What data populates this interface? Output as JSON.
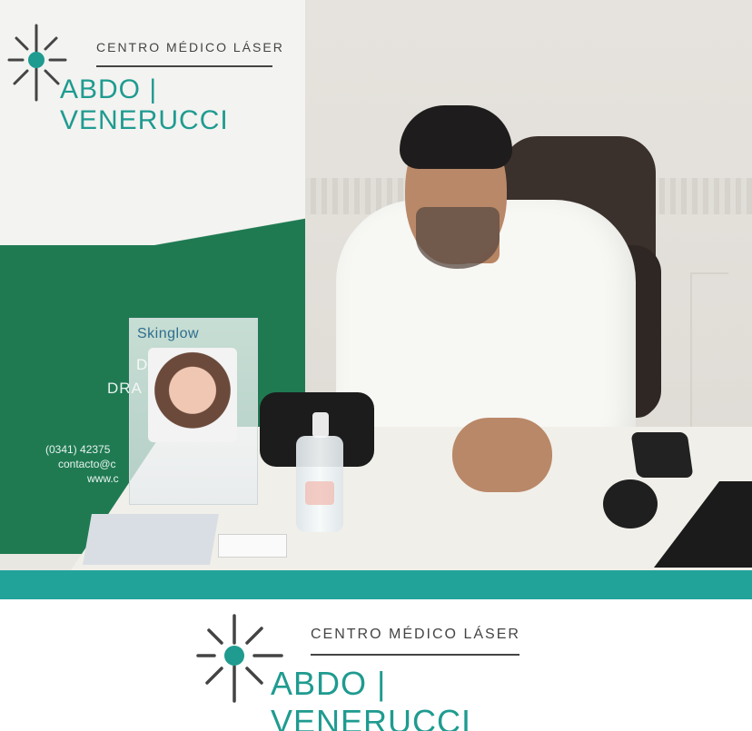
{
  "brand": {
    "logo_subtitle": "CENTRO MÉDICO LÁSER",
    "logo_title": "ABDO | VENERUCCI"
  },
  "photo": {
    "banner_partial_lines": [
      "DR",
      "DRA",
      "(0341) 42375",
      "contacto@c",
      "www.c"
    ],
    "brochure_brand": "Skinglow",
    "colors": {
      "banner_green": "#1f7a52",
      "teal_bar": "#21a39a",
      "logo_teal": "#1f9b90",
      "logo_dark": "#444444"
    }
  }
}
